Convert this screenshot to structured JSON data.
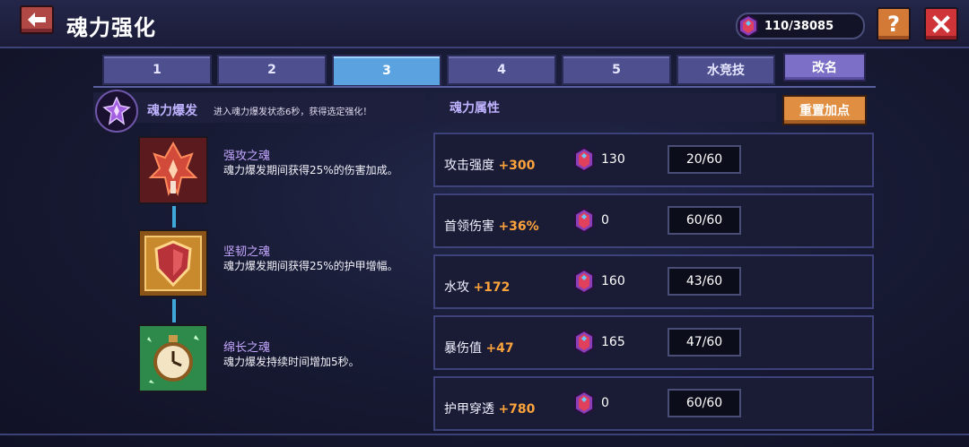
{
  "header": {
    "title": "魂力强化",
    "currency": "110/38085",
    "help_label": "?"
  },
  "tabs": [
    "1",
    "2",
    "3",
    "4",
    "5",
    "水竞技"
  ],
  "active_tab": "3",
  "rename_label": "改名",
  "burst": {
    "title": "魂力爆发",
    "description": "进入魂力爆发状态6秒，获得选定强化！"
  },
  "skills": [
    {
      "name": "强攻之魂",
      "description": "魂力爆发期间获得25%的伤害加成。"
    },
    {
      "name": "坚韧之魂",
      "description": "魂力爆发期间获得25%的护甲增幅。"
    },
    {
      "name": "绵长之魂",
      "description": "魂力爆发持续时间增加5秒。"
    }
  ],
  "attributes": {
    "title": "魂力属性",
    "reset_label": "重置加点",
    "rows": [
      {
        "label": "攻击强度",
        "bonus": "+300",
        "cost": "130",
        "level": "20/60"
      },
      {
        "label": "首领伤害",
        "bonus": "+36%",
        "cost": "0",
        "level": "60/60"
      },
      {
        "label": "水攻",
        "bonus": "+172",
        "cost": "160",
        "level": "43/60"
      },
      {
        "label": "暴伤值",
        "bonus": "+47",
        "cost": "165",
        "level": "47/60"
      },
      {
        "label": "护甲穿透",
        "bonus": "+780",
        "cost": "0",
        "level": "60/60"
      }
    ]
  },
  "colors": {
    "accent_tab": "#5aa3e0",
    "bonus": "#ffa43c",
    "reset": "#e08f42",
    "close": "#cf3438",
    "help": "#d47a37"
  },
  "icons": [
    "back-arrow-icon",
    "soul-gem-icon",
    "help-icon",
    "close-icon",
    "burst-crystal-icon",
    "attack-soul-icon",
    "tough-soul-icon",
    "long-soul-icon"
  ]
}
